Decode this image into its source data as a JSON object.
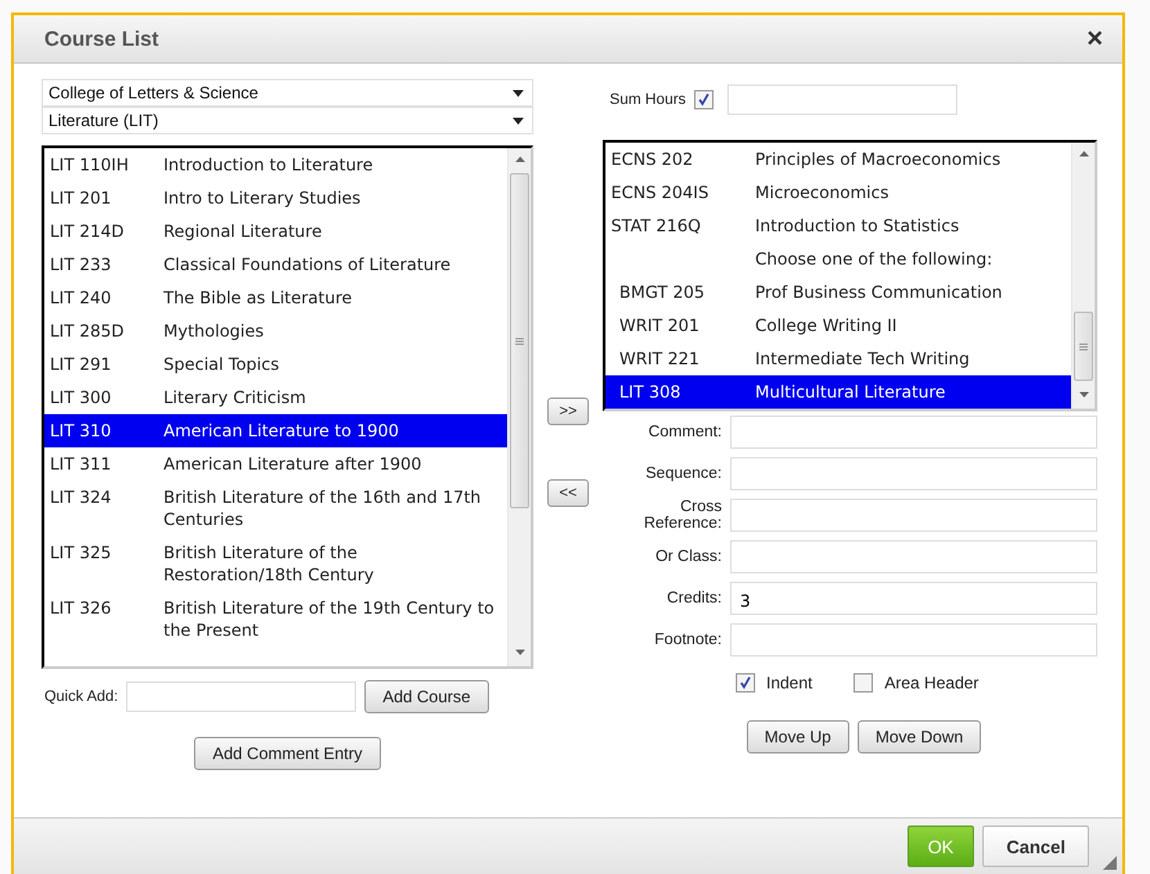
{
  "dialog": {
    "title": "Course List",
    "close": "×"
  },
  "college_select": {
    "value": "College of Letters & Science"
  },
  "subject_select": {
    "value": "Literature (LIT)"
  },
  "available_courses": [
    {
      "code": "LIT 110IH",
      "title": "Introduction to Literature",
      "selected": false
    },
    {
      "code": "LIT 201",
      "title": "Intro to Literary Studies",
      "selected": false
    },
    {
      "code": "LIT 214D",
      "title": "Regional Literature",
      "selected": false
    },
    {
      "code": "LIT 233",
      "title": "Classical Foundations of Literature",
      "selected": false
    },
    {
      "code": "LIT 240",
      "title": "The Bible as Literature",
      "selected": false
    },
    {
      "code": "LIT 285D",
      "title": "Mythologies",
      "selected": false
    },
    {
      "code": "LIT 291",
      "title": "Special Topics",
      "selected": false
    },
    {
      "code": "LIT 300",
      "title": "Literary Criticism",
      "selected": false
    },
    {
      "code": "LIT 310",
      "title": "American Literature to 1900",
      "selected": true
    },
    {
      "code": "LIT 311",
      "title": "American Literature after 1900",
      "selected": false
    },
    {
      "code": "LIT 324",
      "title": "British Literature of the 16th and 17th Centuries",
      "selected": false
    },
    {
      "code": "LIT 325",
      "title": "British Literature of the Restoration/18th Century",
      "selected": false
    },
    {
      "code": "LIT 326",
      "title": "British Literature of the 19th Century to the Present",
      "selected": false
    }
  ],
  "transfer_buttons": [
    ">>",
    "<<"
  ],
  "sum_hours": {
    "label": "Sum Hours",
    "checked": true
  },
  "plan_courses": [
    {
      "kind": "course",
      "code": "ECNS 202",
      "title": "Principles of Macroeconomics",
      "indented": false,
      "selected": false
    },
    {
      "kind": "course",
      "code": "ECNS 204IS",
      "title": "Microeconomics",
      "indented": false,
      "selected": false
    },
    {
      "kind": "course",
      "code": "STAT 216Q",
      "title": "Introduction to Statistics",
      "indented": false,
      "selected": false
    },
    {
      "kind": "header",
      "title": "Choose one of the following:",
      "selected": false
    },
    {
      "kind": "course",
      "code": "BMGT 205",
      "title": "Prof Business Communication",
      "indented": true,
      "selected": false
    },
    {
      "kind": "course",
      "code": "WRIT 201",
      "title": "College Writing II",
      "indented": true,
      "selected": false
    },
    {
      "kind": "course",
      "code": "WRIT 221",
      "title": "Intermediate Tech Writing",
      "indented": true,
      "selected": false
    },
    {
      "kind": "course",
      "code": "LIT 308",
      "title": "Multicultural Literature",
      "indented": true,
      "selected": true
    }
  ],
  "form_fields": [
    {
      "label": "Comment:"
    },
    {
      "label": "Sequence:"
    },
    {
      "label": "Cross Reference:"
    },
    {
      "label": "Or Class:"
    },
    {
      "label": "Credits:",
      "value": "3"
    },
    {
      "label": "Footnote:"
    }
  ],
  "options": [
    {
      "label": "Indent",
      "checked": true
    },
    {
      "label": "Area Header",
      "checked": false
    }
  ],
  "quick_add": {
    "label": "Quick Add:",
    "button": "Add Course"
  },
  "add_comment_button": "Add Comment Entry",
  "move_buttons": [
    "Move Up",
    "Move Down"
  ],
  "footer_buttons": [
    {
      "label": "OK",
      "kind": "primary"
    },
    {
      "label": "Cancel",
      "kind": "secondary"
    }
  ]
}
